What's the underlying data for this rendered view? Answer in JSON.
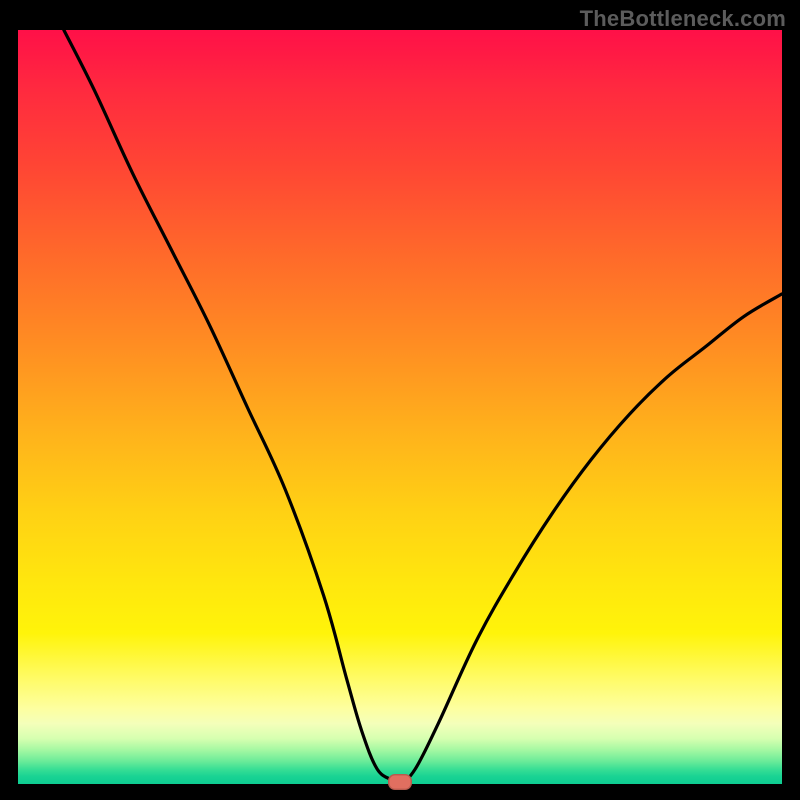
{
  "watermark": "TheBottleneck.com",
  "colors": {
    "page_bg": "#000000",
    "curve_stroke": "#000000",
    "marker_fill": "#e16f60",
    "gradient_top": "#ff1048",
    "gradient_mid": "#fff40a",
    "gradient_bottom": "#0ecd92"
  },
  "chart_data": {
    "type": "line",
    "title": "",
    "xlabel": "",
    "ylabel": "",
    "xlim": [
      0,
      100
    ],
    "ylim": [
      0,
      100
    ],
    "grid": false,
    "legend": false,
    "series": [
      {
        "name": "bottleneck-curve",
        "x": [
          6,
          10,
          15,
          20,
          25,
          30,
          35,
          40,
          43,
          45,
          47,
          49,
          50,
          52,
          55,
          60,
          65,
          70,
          75,
          80,
          85,
          90,
          95,
          100
        ],
        "y": [
          100,
          92,
          81,
          71,
          61,
          50,
          39,
          25,
          14,
          7,
          2,
          0.5,
          0,
          2,
          8,
          19,
          28,
          36,
          43,
          49,
          54,
          58,
          62,
          65
        ]
      }
    ],
    "marker": {
      "x": 50,
      "y": 0
    },
    "notes": "V-shaped curve over a vertical rainbow heat gradient; y-values are bottleneck percentage estimates read visually (no axis ticks shown)."
  }
}
